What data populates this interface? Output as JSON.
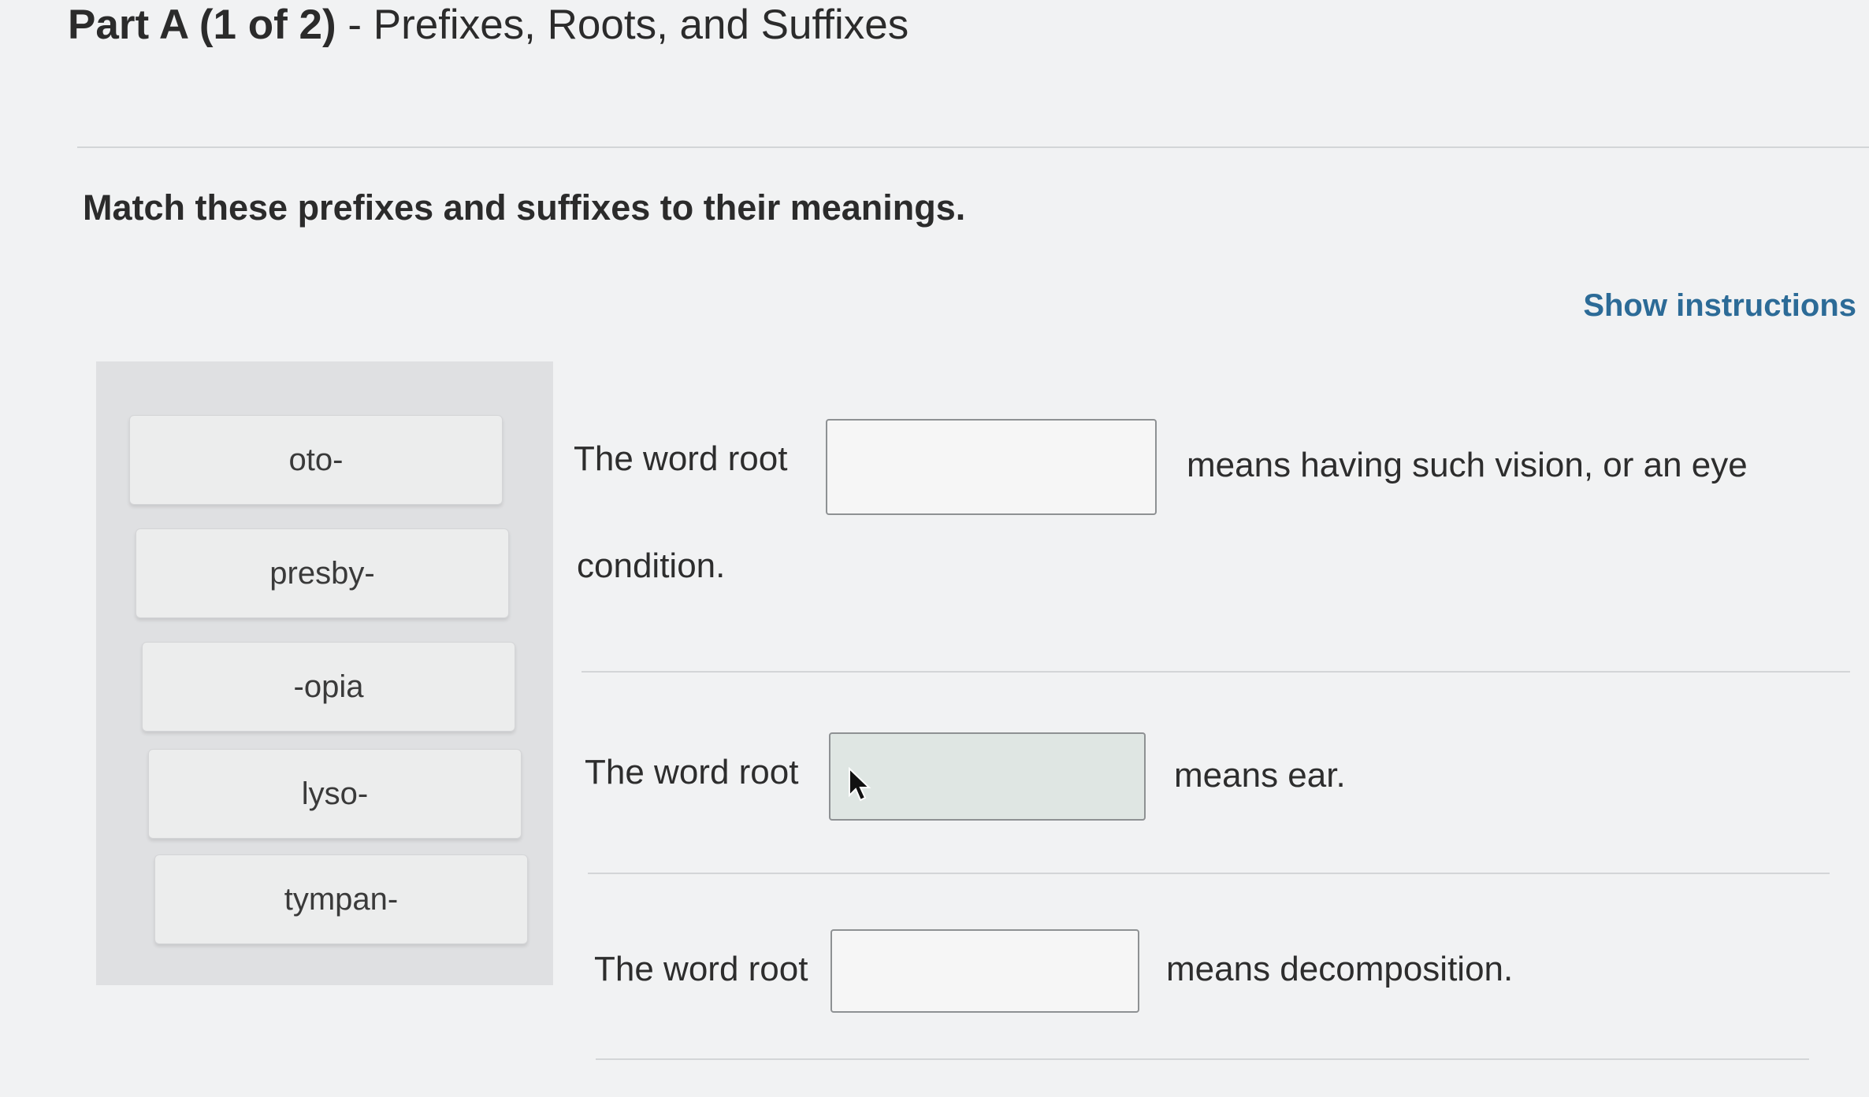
{
  "header": {
    "part_label": "Part A (1 of 2)",
    "title_rest": " - Prefixes, Roots, and Suffixes"
  },
  "prompt": "Match these prefixes and suffixes to their meanings.",
  "show_instructions_label": "Show instructions",
  "word_bank": {
    "items": [
      "oto-",
      "presby-",
      "-opia",
      "lyso-",
      "tympan-"
    ]
  },
  "questions": [
    {
      "prefix": "The word root",
      "answer": "",
      "suffix_line1": "means having such vision, or an eye",
      "suffix_line2": "condition."
    },
    {
      "prefix": "The word root",
      "answer": "",
      "suffix": "means ear."
    },
    {
      "prefix": "The word root",
      "answer": "",
      "suffix": "means decomposition."
    }
  ]
}
